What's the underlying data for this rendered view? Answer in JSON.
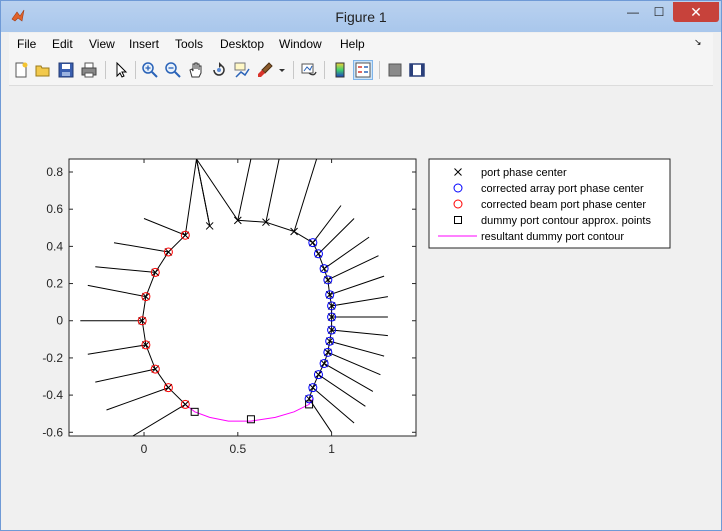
{
  "window": {
    "title": "Figure 1",
    "minimize_glyph": "—",
    "maximize_glyph": "☐",
    "close_glyph": "✕"
  },
  "menubar": {
    "items": [
      "File",
      "Edit",
      "View",
      "Insert",
      "Tools",
      "Desktop",
      "Window",
      "Help"
    ],
    "overflow_glyph": "↘"
  },
  "toolbar": {
    "icons": [
      "new-figure-icon",
      "open-file-icon",
      "save-icon",
      "print-icon",
      "pointer-icon",
      "zoom-in-icon",
      "zoom-out-icon",
      "pan-icon",
      "rotate-3d-icon",
      "data-cursor-icon",
      "brush-icon",
      "brush-dropdown-icon",
      "link-plot-icon",
      "colorbar-icon",
      "legend-icon",
      "hide-plot-tools-icon",
      "show-plot-tools-icon"
    ],
    "active": "legend-icon"
  },
  "chart_data": {
    "type": "scatter",
    "xlim": [
      -0.4,
      1.45
    ],
    "ylim": [
      -0.62,
      0.87
    ],
    "xticks": [
      "0",
      "0.5",
      "1"
    ],
    "xtick_values": [
      0,
      0.5,
      1
    ],
    "yticks": [
      "0.8",
      "0.6",
      "0.4",
      "0.2",
      "0",
      "-0.2",
      "-0.4",
      "-0.6"
    ],
    "ytick_values": [
      0.8,
      0.6,
      0.4,
      0.2,
      0,
      -0.2,
      -0.4,
      -0.6
    ],
    "grid": false,
    "legend_placement": "outside-right",
    "legend": [
      {
        "label": "port phase center",
        "marker": "x",
        "color": "#000000"
      },
      {
        "label": "corrected array port phase center",
        "marker": "o",
        "color": "#0000ff"
      },
      {
        "label": "corrected beam port phase center",
        "marker": "o",
        "color": "#ff0000"
      },
      {
        "label": "dummy port contour approx. points",
        "marker": "s",
        "color": "#000000"
      },
      {
        "label": "resultant dummy port contour",
        "marker": "line",
        "color": "#ff00ff"
      }
    ],
    "series": [
      {
        "name": "port phase center",
        "marker": "x",
        "color": "#000000",
        "x": [
          0.35,
          0.5,
          0.65,
          0.8,
          0.9,
          0.93,
          0.96,
          0.98,
          0.99,
          1.0,
          1.0,
          1.0,
          0.99,
          0.98,
          0.96,
          0.93,
          0.9,
          0.88,
          0.22,
          0.13,
          0.06,
          0.01,
          -0.01,
          0.01,
          0.06,
          0.13,
          0.22
        ],
        "y": [
          0.51,
          0.54,
          0.53,
          0.48,
          0.42,
          0.36,
          0.28,
          0.22,
          0.14,
          0.08,
          0.02,
          -0.05,
          -0.11,
          -0.17,
          -0.23,
          -0.29,
          -0.36,
          -0.42,
          0.46,
          0.37,
          0.26,
          0.13,
          0.0,
          -0.13,
          -0.26,
          -0.36,
          -0.45
        ]
      },
      {
        "name": "corrected array port phase center",
        "marker": "o",
        "color": "#0000ff",
        "x": [
          0.9,
          0.93,
          0.96,
          0.98,
          0.99,
          1.0,
          1.0,
          1.0,
          0.99,
          0.98,
          0.96,
          0.93,
          0.9,
          0.88
        ],
        "y": [
          0.42,
          0.36,
          0.28,
          0.22,
          0.14,
          0.08,
          0.02,
          -0.05,
          -0.11,
          -0.17,
          -0.23,
          -0.29,
          -0.36,
          -0.42
        ]
      },
      {
        "name": "corrected beam port phase center",
        "marker": "o",
        "color": "#ff0000",
        "x": [
          0.22,
          0.13,
          0.06,
          0.01,
          -0.01,
          0.01,
          0.06,
          0.13,
          0.22
        ],
        "y": [
          0.46,
          0.37,
          0.26,
          0.13,
          0.0,
          -0.13,
          -0.26,
          -0.36,
          -0.45
        ]
      },
      {
        "name": "dummy port contour approx. points",
        "marker": "s",
        "color": "#000000",
        "x": [
          0.27,
          0.57,
          0.88
        ],
        "y": [
          -0.49,
          -0.53,
          -0.45
        ]
      },
      {
        "name": "resultant dummy port contour",
        "marker": "line",
        "color": "#ff00ff",
        "x": [
          0.22,
          0.27,
          0.35,
          0.45,
          0.57,
          0.7,
          0.8,
          0.88,
          0.9
        ],
        "y": [
          -0.45,
          -0.49,
          -0.52,
          -0.54,
          -0.54,
          -0.52,
          -0.49,
          -0.45,
          -0.42
        ]
      },
      {
        "name": "port outline",
        "marker": "line",
        "color": "#000000",
        "x": [
          0.35,
          0.28,
          0.5,
          0.57,
          0.5,
          0.65,
          0.72,
          0.65,
          0.8,
          0.92,
          0.8,
          0.9,
          1.05,
          0.9,
          0.93,
          1.12,
          0.93,
          0.96,
          1.2,
          0.96,
          0.98,
          1.25,
          0.98,
          0.99,
          1.28,
          0.99,
          1.0,
          1.3,
          1.0,
          1.0,
          1.3,
          1.0,
          1.0,
          1.3,
          1.0,
          0.99,
          1.28,
          0.99,
          0.98,
          1.26,
          0.98,
          0.96,
          1.22,
          0.96,
          0.93,
          1.18,
          0.93,
          0.9,
          1.12,
          0.9,
          0.88,
          1.0,
          0.88
        ],
        "y": [
          0.51,
          0.87,
          0.54,
          0.87,
          0.54,
          0.53,
          0.87,
          0.53,
          0.48,
          0.87,
          0.48,
          0.42,
          0.62,
          0.42,
          0.36,
          0.55,
          0.36,
          0.28,
          0.45,
          0.28,
          0.22,
          0.35,
          0.22,
          0.14,
          0.24,
          0.14,
          0.08,
          0.13,
          0.08,
          0.02,
          0.02,
          0.02,
          -0.05,
          -0.08,
          -0.05,
          -0.11,
          -0.19,
          -0.11,
          -0.17,
          -0.29,
          -0.17,
          -0.23,
          -0.38,
          -0.23,
          -0.29,
          -0.46,
          -0.29,
          -0.36,
          -0.55,
          -0.36,
          -0.42,
          -0.6,
          -0.42
        ]
      },
      {
        "name": "beam outline",
        "marker": "line",
        "color": "#000000",
        "x": [
          0.35,
          0.28,
          0.22,
          0.0,
          0.22,
          0.13,
          -0.16,
          0.13,
          0.06,
          -0.26,
          0.06,
          0.01,
          -0.3,
          0.01,
          -0.01,
          -0.34,
          -0.01,
          0.01,
          -0.3,
          0.01,
          0.06,
          -0.26,
          0.06,
          0.13,
          -0.2,
          0.13,
          0.22,
          -0.06,
          0.22
        ],
        "y": [
          0.51,
          0.87,
          0.46,
          0.55,
          0.46,
          0.37,
          0.42,
          0.37,
          0.26,
          0.29,
          0.26,
          0.13,
          0.19,
          0.13,
          0.0,
          0.0,
          0.0,
          -0.13,
          -0.18,
          -0.13,
          -0.26,
          -0.33,
          -0.26,
          -0.36,
          -0.48,
          -0.36,
          -0.45,
          -0.62,
          -0.45
        ]
      }
    ]
  }
}
